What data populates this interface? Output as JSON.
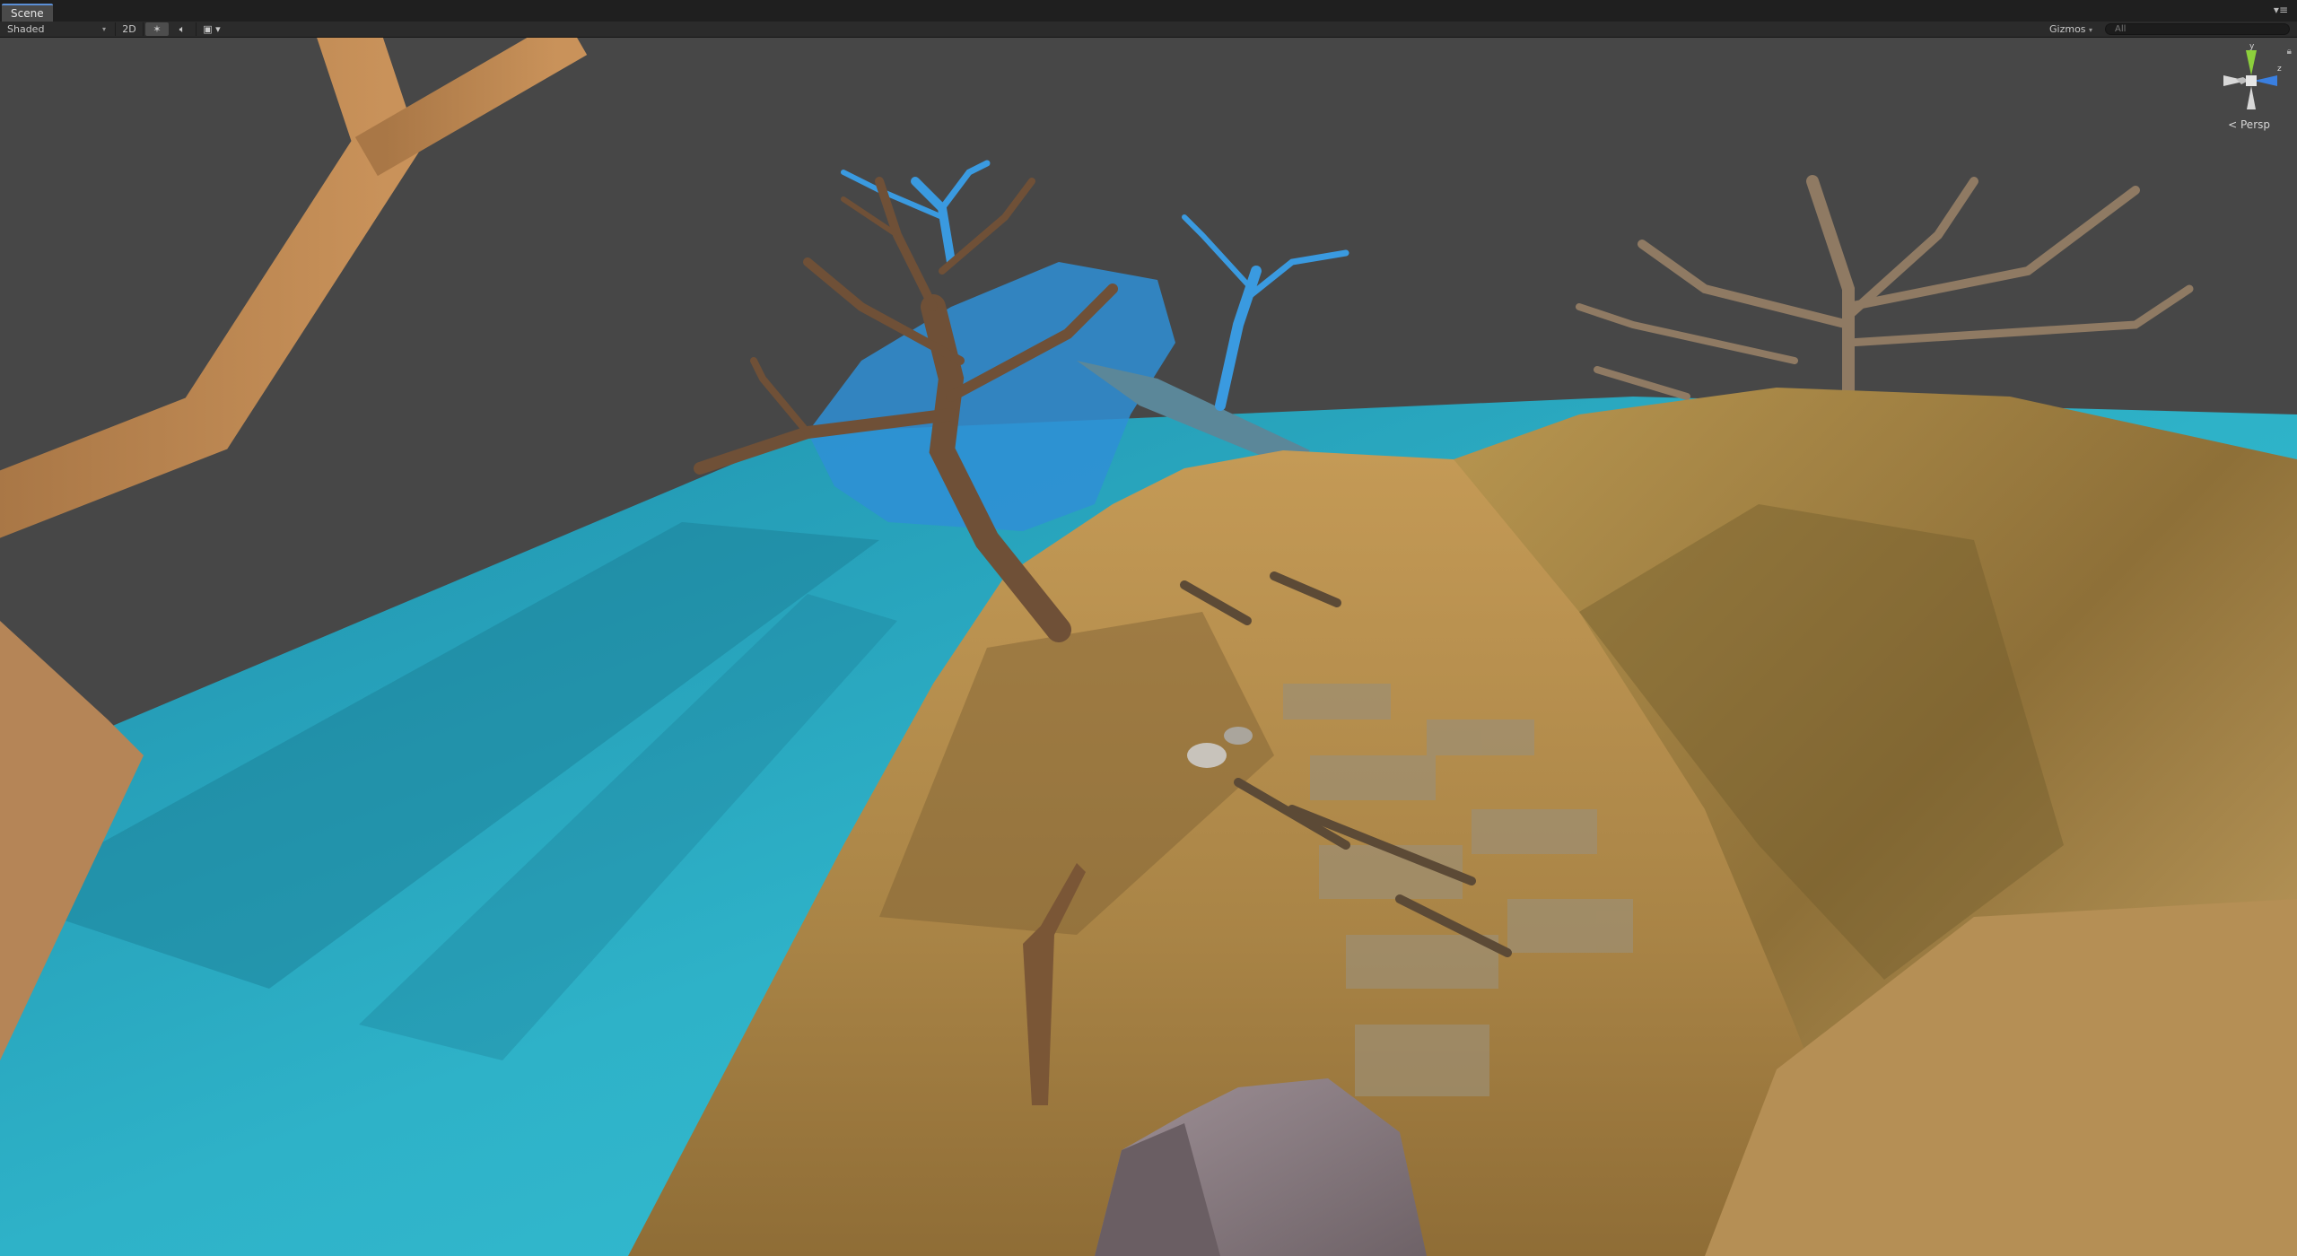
{
  "scene_tab": {
    "label": "Scene"
  },
  "window_menu": {
    "glyph": "▾≡"
  },
  "toolbar": {
    "shading_mode": "Shaded",
    "mode_2d": "2D",
    "lighting_icon": "sun-icon",
    "audio_icon": "speaker-icon",
    "effects_icon": "image-icon",
    "gizmos_label": "Gizmos",
    "search_placeholder": "All"
  },
  "orientation_gizmo": {
    "axis_y": "y",
    "axis_z": "z",
    "projection_label": "Persp",
    "colors": {
      "y": "#8cd03c",
      "z": "#3a7fe0",
      "center": "#e6e6e6"
    }
  },
  "scene_colors": {
    "sky": "#474747",
    "water": "#2aa7be",
    "terrain": "#b08a4a",
    "tree_brown": "#8b6a45",
    "tree_selected": "#2f8fd6",
    "rock": "#8a7c80"
  }
}
